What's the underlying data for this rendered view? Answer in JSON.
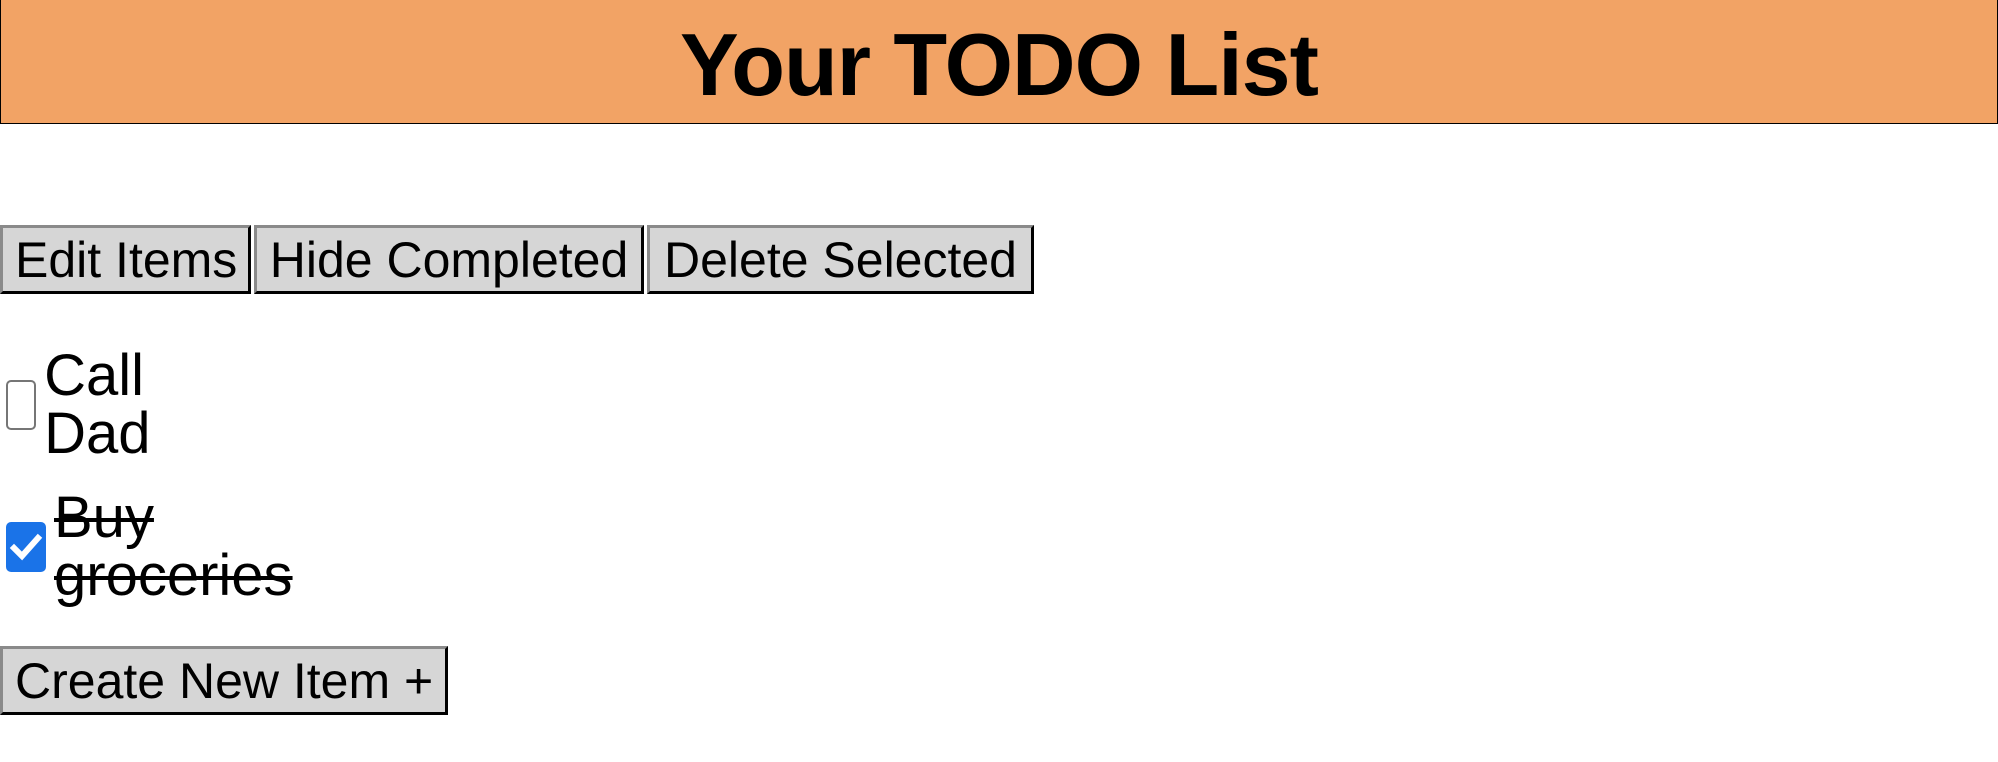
{
  "header": {
    "title": "Your TODO List",
    "background_color": "#f2a365"
  },
  "toolbar": {
    "edit_label": "Edit Items",
    "hide_label": "Hide Completed",
    "delete_label": "Delete Selected"
  },
  "todos": [
    {
      "label": "Call Dad",
      "checked": false
    },
    {
      "label": "Buy groceries",
      "checked": true
    }
  ],
  "create": {
    "label": "Create New Item +"
  },
  "colors": {
    "checkbox_checked": "#1a73e8",
    "button_bg": "#d6d6d6"
  },
  "icons": {
    "checkmark": "check-icon"
  }
}
